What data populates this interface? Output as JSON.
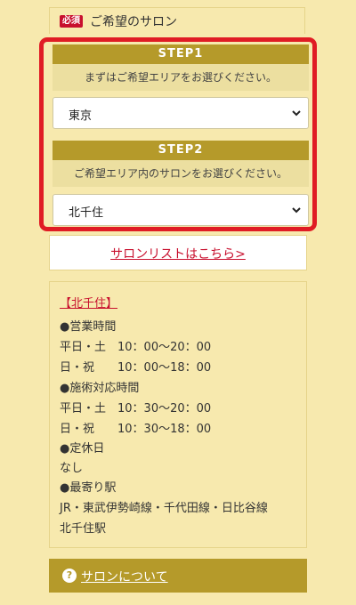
{
  "header": {
    "badge": "必須",
    "title": "ご希望のサロン"
  },
  "step1": {
    "label": "STEP1",
    "note": "まずはご希望エリアをお選びください。",
    "selected": "東京"
  },
  "step2": {
    "label": "STEP2",
    "note": "ご希望エリア内のサロンをお選びください。",
    "selected": "北千住"
  },
  "salon_list_link": "サロンリストはこちら>",
  "info": {
    "title": "【北千住】",
    "lines": [
      "●営業時間",
      "平日・土　10：00〜20：00",
      "日・祝　　10：00〜18：00",
      "●施術対応時間",
      "平日・土　10：30〜20：00",
      "日・祝　　10：30〜18：00",
      "●定休日",
      "なし",
      "●最寄り駅",
      "JR・東武伊勢崎線・千代田線・日比谷線",
      "北千住駅"
    ]
  },
  "about": {
    "icon": "?",
    "label": "サロンについて"
  },
  "colors": {
    "background": "#f7e9ae",
    "step_bar": "#b59a2a",
    "highlight_frame": "#e01c24",
    "required": "#c8102e"
  }
}
